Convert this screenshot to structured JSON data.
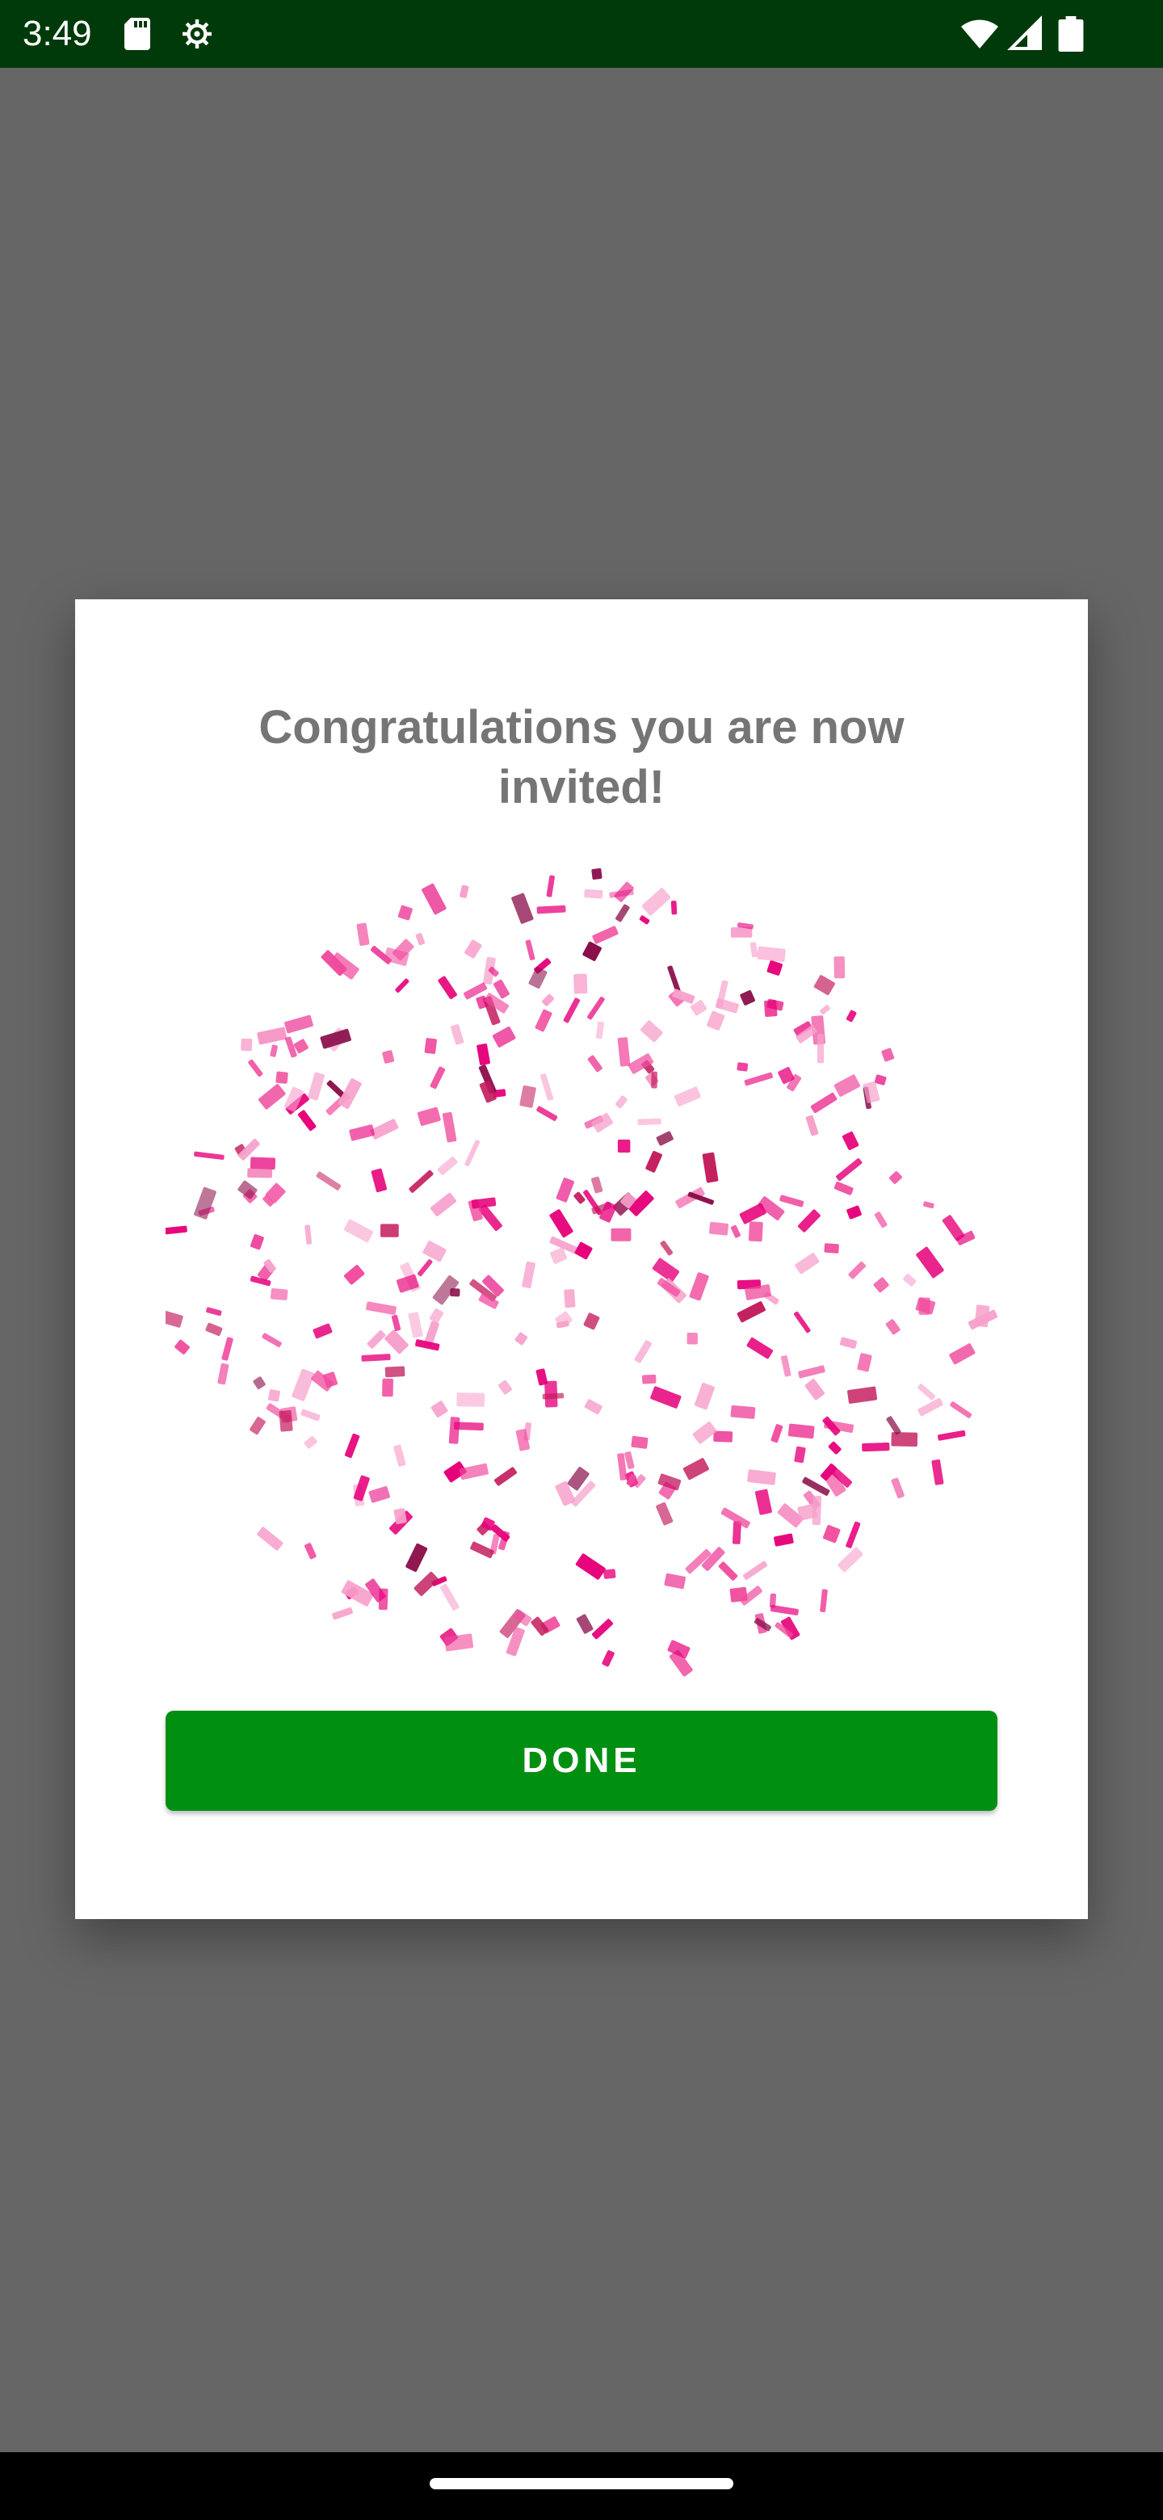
{
  "status_bar": {
    "time": "3:49",
    "icons": [
      "sd-card-icon",
      "settings-icon",
      "wifi-icon",
      "signal-icon",
      "battery-icon"
    ],
    "background": "#003a0b"
  },
  "dialog": {
    "title": "Congratulations you are now invited!",
    "image": "pink-confetti-animation",
    "confetti_colors": [
      "#e6007a",
      "#f04a9c",
      "#f7a1cc",
      "#8a0f4a",
      "#c2185b"
    ],
    "done_label": "DONE",
    "button_color": "#008f11"
  },
  "overlay_color": "#666666",
  "navigation_bar": {
    "handle": "home-gesture-handle"
  }
}
